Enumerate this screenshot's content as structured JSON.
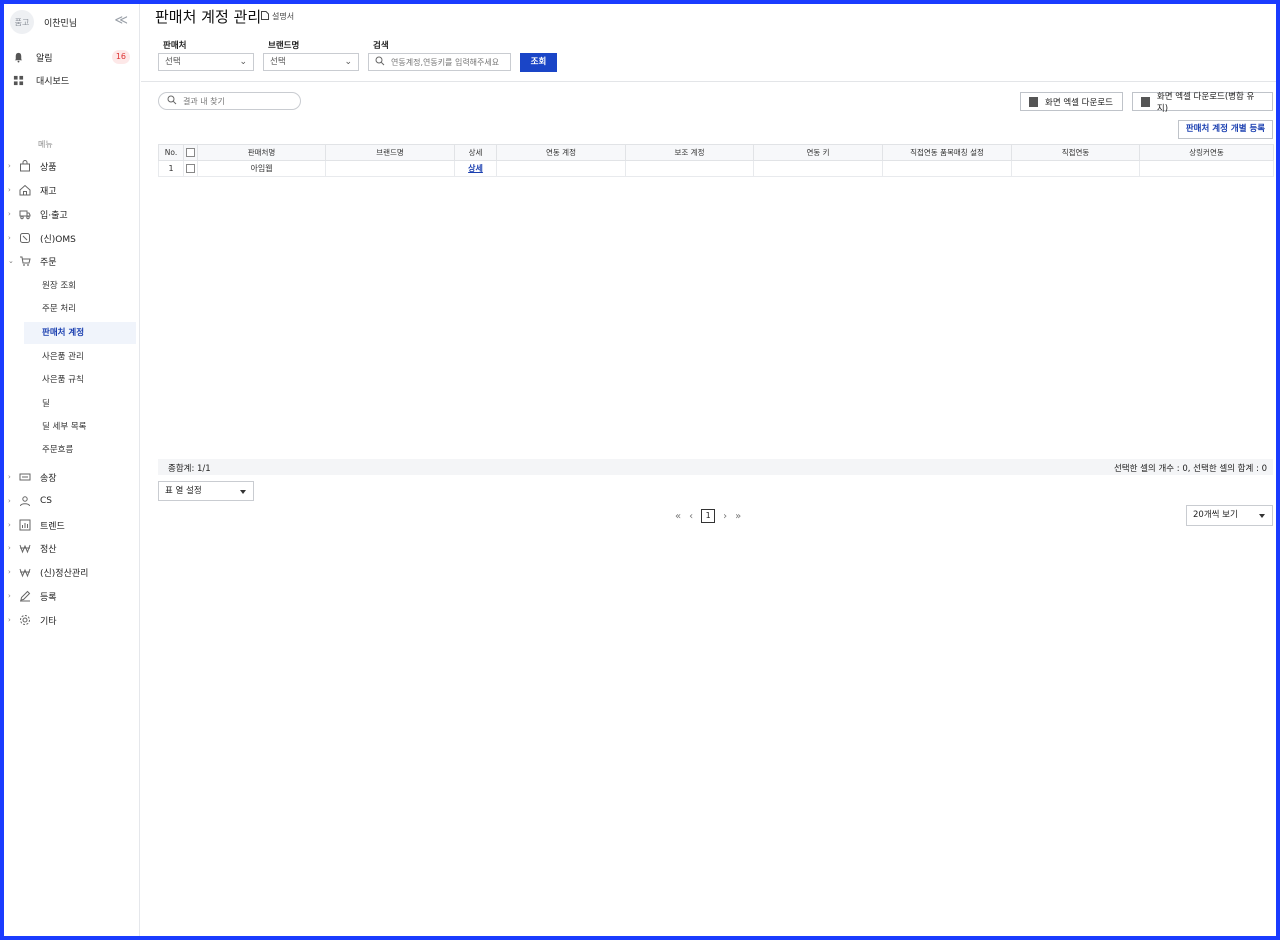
{
  "sidebar": {
    "avatar_text": "품고",
    "username": "이찬민님",
    "collapse_glyph": "≪",
    "alerts_label": "알림",
    "alerts_count": "16",
    "dashboard_label": "대시보드",
    "menu_caption": "메뉴",
    "nav": [
      {
        "label": "상품",
        "icon": "bag-icon"
      },
      {
        "label": "재고",
        "icon": "house-icon"
      },
      {
        "label": "입·출고",
        "icon": "truck-icon"
      },
      {
        "label": "(신)OMS",
        "icon": "oms-icon"
      },
      {
        "label": "주문",
        "icon": "cart-icon"
      }
    ],
    "order_sub": [
      "원장 조회",
      "주문 처리",
      "판매처 계정",
      "사은품 관리",
      "사은품 규칙",
      "딜",
      "딜 세부 목록",
      "주문흐름"
    ],
    "nav2": [
      {
        "label": "송장",
        "icon": "invoice-icon"
      },
      {
        "label": "CS",
        "icon": "person-icon"
      },
      {
        "label": "트렌드",
        "icon": "chart-icon"
      },
      {
        "label": "정산",
        "icon": "won-icon"
      },
      {
        "label": "(신)정산관리",
        "icon": "won-icon"
      },
      {
        "label": "등록",
        "icon": "pen-icon"
      },
      {
        "label": "기타",
        "icon": "gear-icon"
      }
    ]
  },
  "header": {
    "title": "판매처 계정 관리",
    "manual": "설명서"
  },
  "filters": {
    "seller_label": "판매처",
    "seller_value": "선택",
    "brand_label": "브랜드명",
    "brand_value": "선택",
    "search_label": "검색",
    "search_placeholder": "연동계정,연동키를 입력해주세요",
    "search_button": "조회"
  },
  "toolbar": {
    "find_placeholder": "결과 내 찾기",
    "excel_download": "화면 엑셀 다운로드",
    "excel_download_merge": "화면 엑셀 다운로드(병합 유지)",
    "register_button": "판매처 계정 개별 등록"
  },
  "table": {
    "headers": [
      "No.",
      "",
      "판매처명",
      "브랜드명",
      "상세",
      "연동 계정",
      "보조 계정",
      "연동 키",
      "직접연동 품목매칭 설정",
      "직접연동",
      "상링커연동"
    ],
    "rows": [
      {
        "no": "1",
        "seller": "아임웹",
        "brand": "",
        "detail": "상세",
        "account": "",
        "sub_account": "",
        "key": "",
        "direct_setting": "",
        "direct": "",
        "linker": ""
      }
    ]
  },
  "summary": {
    "total": "종합계: 1/1",
    "selection": "선택한 셀의 개수 : 0, 선택한 셀의 합계 : 0"
  },
  "footer": {
    "column_settings": "표 열 설정",
    "current_page": "1",
    "page_size": "20개씩 보기"
  }
}
